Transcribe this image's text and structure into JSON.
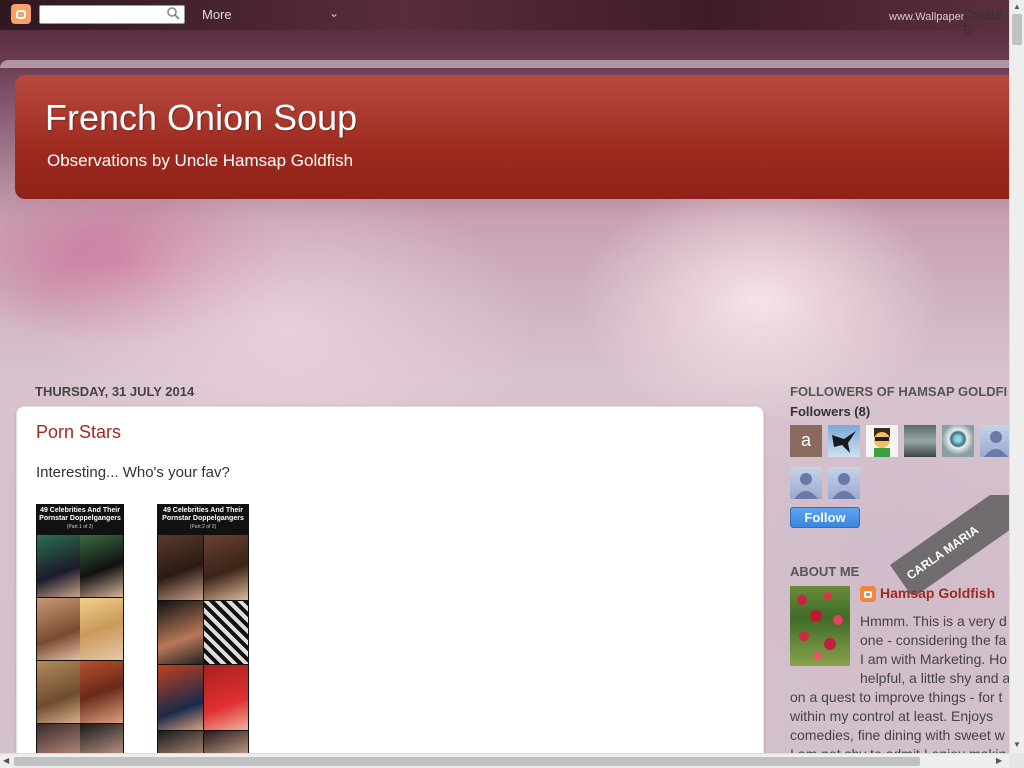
{
  "navbar": {
    "search_value": "",
    "more_label": "More",
    "create_label": "Create B",
    "watermark": "www.Wallpaper"
  },
  "header": {
    "title": "French Onion Soup",
    "description": "Observations by Uncle Hamsap Goldfish"
  },
  "post": {
    "date": "THURSDAY, 31 JULY 2014",
    "title": "Porn Stars",
    "body": "Interesting... Who's your fav?",
    "images": [
      {
        "heading": "49 Celebrities And Their Pornstar Doppelgangers",
        "sub": "(Part 1 of 2)"
      },
      {
        "heading": "49 Celebrities And Their Pornstar Doppelgangers",
        "sub": "(Part 2 of 2)"
      }
    ]
  },
  "sidebar": {
    "followers_heading": "FOLLOWERS OF HAMSAP GOLDFI",
    "followers_count": "Followers (8)",
    "avatar_letter": "a",
    "follow_label": "Follow",
    "promo_text": "CARLA MARIA",
    "about_heading": "ABOUT ME",
    "profile_name": "Hamsap Goldfish",
    "about_lines": [
      "Hmmm. This is a very d",
      "one - considering the fa",
      "I am with Marketing. Ho",
      "helpful, a little shy and a",
      "on a quest to improve things - for t",
      "within my control at least. Enjoys",
      "comedies, fine dining with sweet w",
      "I am not shy to admit I enjoy makin"
    ]
  },
  "colors": {
    "accent": "#9e2a1f",
    "follow": "#3b84dd"
  }
}
